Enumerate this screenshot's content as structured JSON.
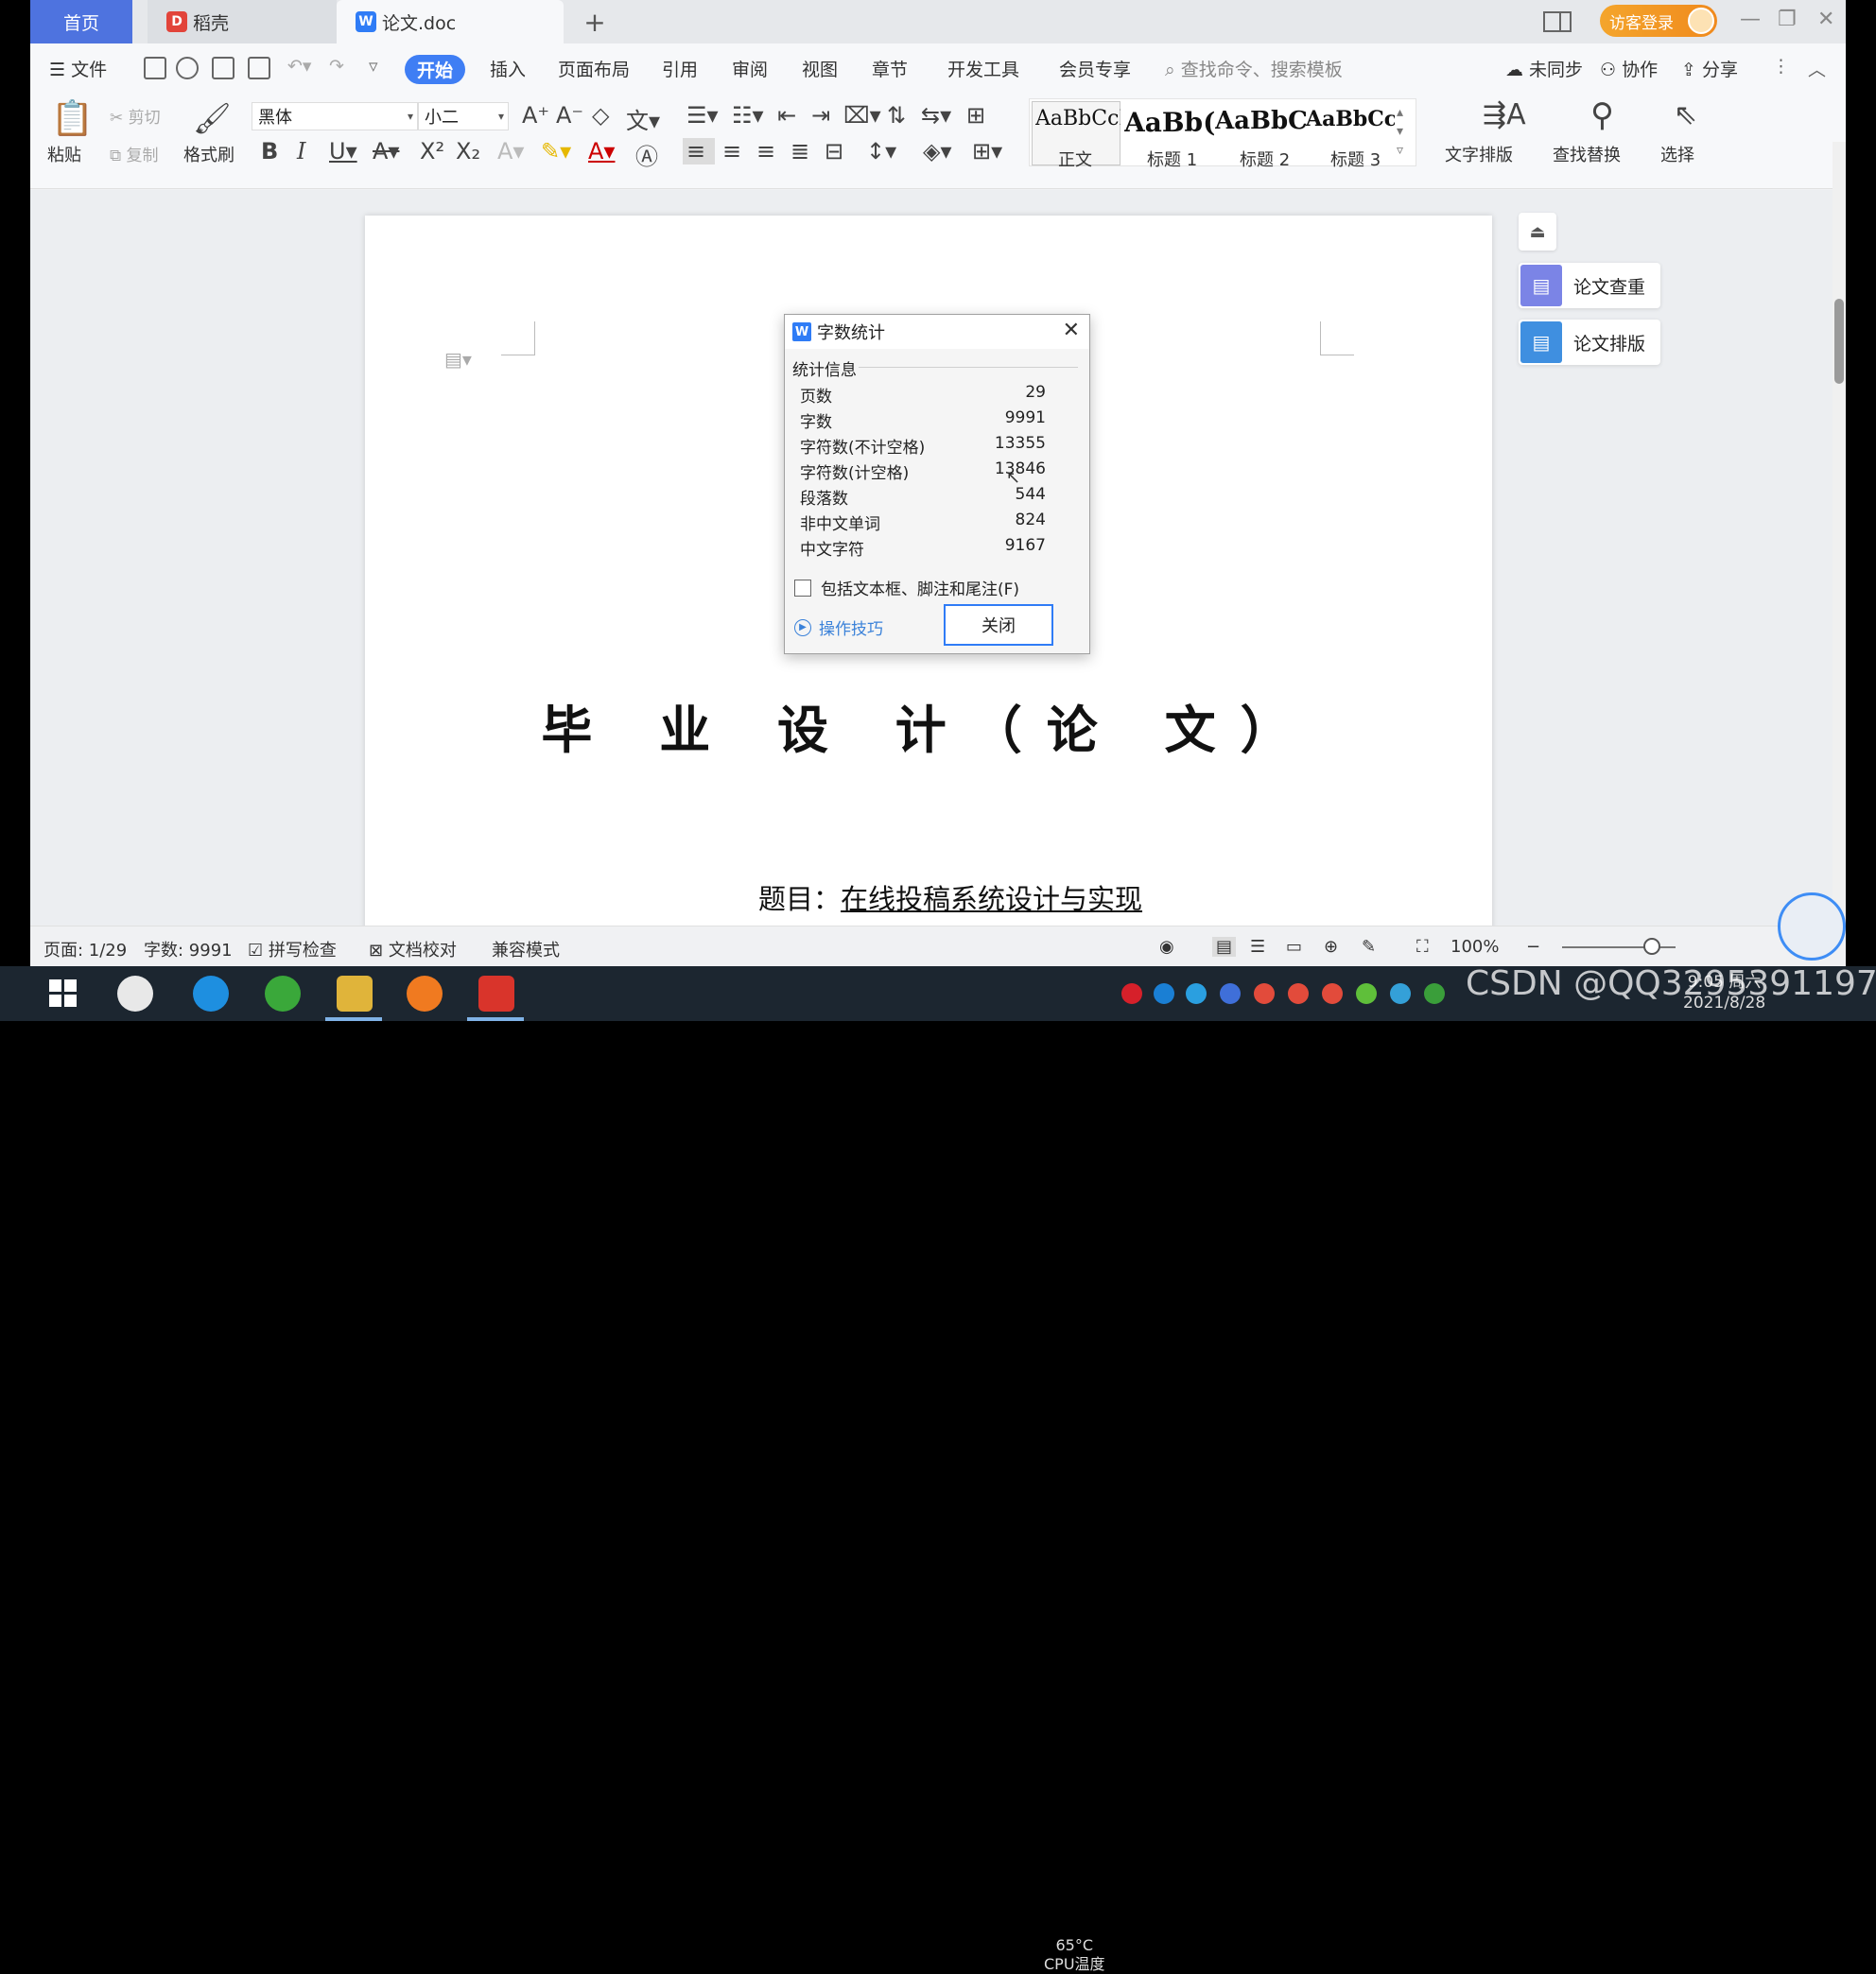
{
  "tabs": {
    "home": "首页",
    "daoke": "稻壳",
    "doc": "论文.doc",
    "add": "+"
  },
  "titlebar": {
    "login": "访客登录"
  },
  "menu": {
    "file": "文件",
    "items": [
      "开始",
      "插入",
      "页面布局",
      "引用",
      "审阅",
      "视图",
      "章节",
      "开发工具",
      "会员专享"
    ],
    "search_placeholder": "查找命令、搜索模板",
    "sync": "未同步",
    "collab": "协作",
    "share": "分享"
  },
  "ribbon": {
    "paste": "粘贴",
    "cut": "剪切",
    "copy": "复制",
    "format_painter": "格式刷",
    "font_name": "黑体",
    "font_size": "小二",
    "styles": [
      {
        "sample": "AaBbCcI",
        "name": "正文"
      },
      {
        "sample": "AaBb(",
        "name": "标题 1"
      },
      {
        "sample": "AaBbC",
        "name": "标题 2"
      },
      {
        "sample": "AaBbCcl",
        "name": "标题 3"
      }
    ],
    "text_layout": "文字排版",
    "find_replace": "查找替换",
    "select": "选择"
  },
  "document": {
    "title": "毕 业 设 计（论 文）",
    "subject_label": "题目：",
    "subject_value": "在线投稿系统设计与实现"
  },
  "side_panel": {
    "check": "论文查重",
    "layout": "论文排版"
  },
  "dialog": {
    "title": "字数统计",
    "section": "统计信息",
    "stats": [
      {
        "label": "页数",
        "value": "29"
      },
      {
        "label": "字数",
        "value": "9991"
      },
      {
        "label": "字符数(不计空格)",
        "value": "13355"
      },
      {
        "label": "字符数(计空格)",
        "value": "13846"
      },
      {
        "label": "段落数",
        "value": "544"
      },
      {
        "label": "非中文单词",
        "value": "824"
      },
      {
        "label": "中文字符",
        "value": "9167"
      }
    ],
    "include_label": "包括文本框、脚注和尾注(F)",
    "tips": "操作技巧",
    "close": "关闭"
  },
  "statusbar": {
    "page": "页面: 1/29",
    "words": "字数: 9991",
    "spell": "拼写检查",
    "proof": "文档校对",
    "compat": "兼容模式",
    "zoom": "100%"
  },
  "taskbar": {
    "temp_top": "65°C",
    "temp_label": "CPU温度",
    "time": "9:05 周六",
    "date": "2021/8/28",
    "watermark": "CSDN @QQ3295391197"
  }
}
